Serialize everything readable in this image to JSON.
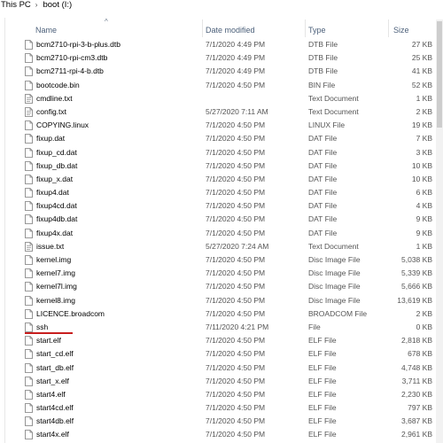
{
  "breadcrumb": [
    "This PC",
    "boot (I:)"
  ],
  "breadcrumb_separator": "›",
  "columns": {
    "name": "Name",
    "date": "Date modified",
    "type": "Type",
    "size": "Size"
  },
  "sort_indicator": "^",
  "files": [
    {
      "name": "bcm2710-rpi-3-b-plus.dtb",
      "date": "7/1/2020 4:49 PM",
      "type": "DTB File",
      "size": "27 KB"
    },
    {
      "name": "bcm2710-rpi-cm3.dtb",
      "date": "7/1/2020 4:49 PM",
      "type": "DTB File",
      "size": "25 KB"
    },
    {
      "name": "bcm2711-rpi-4-b.dtb",
      "date": "7/1/2020 4:49 PM",
      "type": "DTB File",
      "size": "41 KB"
    },
    {
      "name": "bootcode.bin",
      "date": "7/1/2020 4:50 PM",
      "type": "BIN File",
      "size": "52 KB"
    },
    {
      "name": "cmdline.txt",
      "date": "",
      "type": "Text Document",
      "size": "1 KB"
    },
    {
      "name": "config.txt",
      "date": "5/27/2020 7:11 AM",
      "type": "Text Document",
      "size": "2 KB"
    },
    {
      "name": "COPYING.linux",
      "date": "7/1/2020 4:50 PM",
      "type": "LINUX File",
      "size": "19 KB"
    },
    {
      "name": "fixup.dat",
      "date": "7/1/2020 4:50 PM",
      "type": "DAT File",
      "size": "7 KB"
    },
    {
      "name": "fixup_cd.dat",
      "date": "7/1/2020 4:50 PM",
      "type": "DAT File",
      "size": "3 KB"
    },
    {
      "name": "fixup_db.dat",
      "date": "7/1/2020 4:50 PM",
      "type": "DAT File",
      "size": "10 KB"
    },
    {
      "name": "fixup_x.dat",
      "date": "7/1/2020 4:50 PM",
      "type": "DAT File",
      "size": "10 KB"
    },
    {
      "name": "fixup4.dat",
      "date": "7/1/2020 4:50 PM",
      "type": "DAT File",
      "size": "6 KB"
    },
    {
      "name": "fixup4cd.dat",
      "date": "7/1/2020 4:50 PM",
      "type": "DAT File",
      "size": "4 KB"
    },
    {
      "name": "fixup4db.dat",
      "date": "7/1/2020 4:50 PM",
      "type": "DAT File",
      "size": "9 KB"
    },
    {
      "name": "fixup4x.dat",
      "date": "7/1/2020 4:50 PM",
      "type": "DAT File",
      "size": "9 KB"
    },
    {
      "name": "issue.txt",
      "date": "5/27/2020 7:24 AM",
      "type": "Text Document",
      "size": "1 KB"
    },
    {
      "name": "kernel.img",
      "date": "7/1/2020 4:50 PM",
      "type": "Disc Image File",
      "size": "5,038 KB"
    },
    {
      "name": "kernel7.img",
      "date": "7/1/2020 4:50 PM",
      "type": "Disc Image File",
      "size": "5,339 KB"
    },
    {
      "name": "kernel7l.img",
      "date": "7/1/2020 4:50 PM",
      "type": "Disc Image File",
      "size": "5,666 KB"
    },
    {
      "name": "kernel8.img",
      "date": "7/1/2020 4:50 PM",
      "type": "Disc Image File",
      "size": "13,619 KB"
    },
    {
      "name": "LICENCE.broadcom",
      "date": "7/1/2020 4:50 PM",
      "type": "BROADCOM File",
      "size": "2 KB"
    },
    {
      "name": "ssh",
      "date": "7/11/2020 4:21 PM",
      "type": "File",
      "size": "0 KB",
      "underlined": true
    },
    {
      "name": "start.elf",
      "date": "7/1/2020 4:50 PM",
      "type": "ELF File",
      "size": "2,818 KB"
    },
    {
      "name": "start_cd.elf",
      "date": "7/1/2020 4:50 PM",
      "type": "ELF File",
      "size": "678 KB"
    },
    {
      "name": "start_db.elf",
      "date": "7/1/2020 4:50 PM",
      "type": "ELF File",
      "size": "4,748 KB"
    },
    {
      "name": "start_x.elf",
      "date": "7/1/2020 4:50 PM",
      "type": "ELF File",
      "size": "3,711 KB"
    },
    {
      "name": "start4.elf",
      "date": "7/1/2020 4:50 PM",
      "type": "ELF File",
      "size": "2,230 KB"
    },
    {
      "name": "start4cd.elf",
      "date": "7/1/2020 4:50 PM",
      "type": "ELF File",
      "size": "797 KB"
    },
    {
      "name": "start4db.elf",
      "date": "7/1/2020 4:50 PM",
      "type": "ELF File",
      "size": "3,687 KB"
    },
    {
      "name": "start4x.elf",
      "date": "7/1/2020 4:50 PM",
      "type": "ELF File",
      "size": "2,961 KB"
    }
  ],
  "colors": {
    "underline": "#c81e1e",
    "header_text": "#4c607a"
  },
  "icons": {
    "file": "file-icon",
    "text_file": "text-file-icon"
  }
}
